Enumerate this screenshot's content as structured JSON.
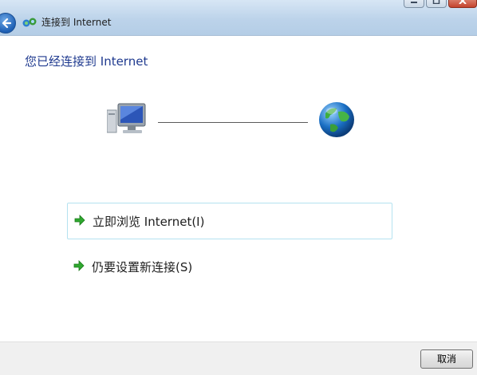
{
  "window": {
    "title": "连接到 Internet",
    "controls": [
      "minimize",
      "maximize",
      "close"
    ]
  },
  "header": {
    "back_icon": "back-arrow-icon",
    "net_icon": "network-connection-icon"
  },
  "main": {
    "heading": "您已经连接到 Internet",
    "illustration": {
      "left_icon": "computer-icon",
      "right_icon": "globe-icon"
    },
    "options": [
      {
        "label": "立即浏览 Internet(I)",
        "icon": "green-arrow-icon",
        "highlighted": true
      },
      {
        "label": "仍要设置新连接(S)",
        "icon": "green-arrow-icon",
        "highlighted": false
      }
    ]
  },
  "footer": {
    "cancel_label": "取消"
  },
  "colors": {
    "heading": "#1f3a8f",
    "selection_border": "#b4e2f0",
    "arrow": "#2fa82f"
  }
}
